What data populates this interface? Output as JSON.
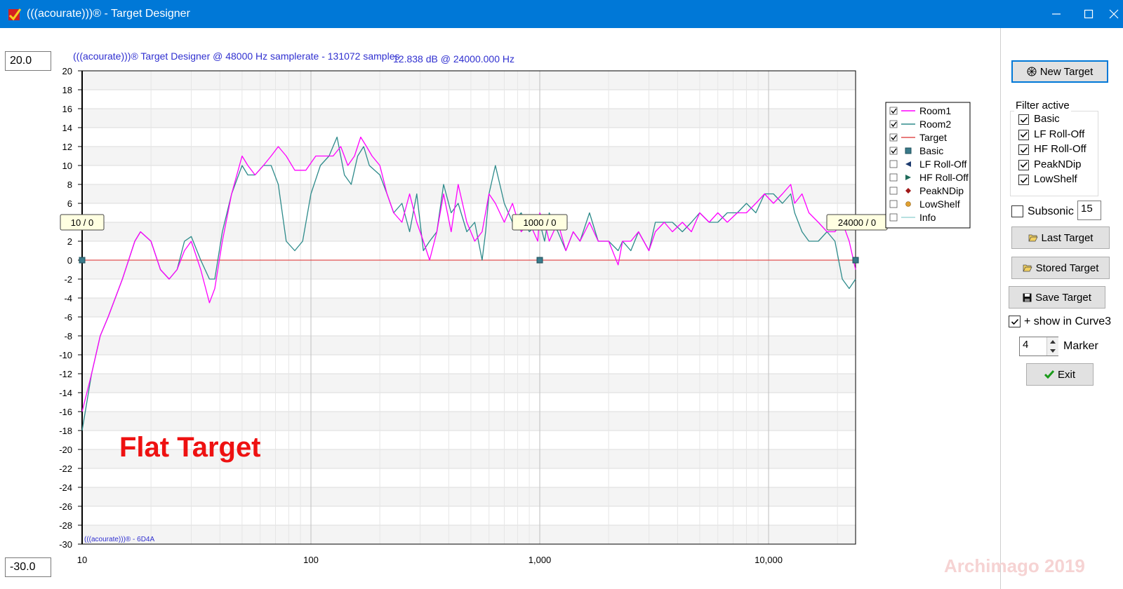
{
  "window": {
    "title": "(((acourate)))® - Target Designer",
    "titlebar_color": "#0078d7"
  },
  "scale": {
    "max": "20.0",
    "min": "-30.0"
  },
  "chart_data": {
    "type": "line",
    "title": "(((acourate)))® Target Designer @ 48000 Hz samplerate - 131072 samples",
    "readout": "12.838 dB @ 24000.000 Hz",
    "footer": "(((acourate)))® - 6D4A",
    "overlay_text": "Flat Target",
    "x_scale": "log",
    "xlim": [
      10,
      24000
    ],
    "ylim": [
      -30,
      20
    ],
    "x_ticks": [
      10,
      100,
      1000,
      10000
    ],
    "x_tick_labels": [
      "10",
      "100",
      "1,000",
      "10,000"
    ],
    "y_ticks": [
      20,
      18,
      16,
      14,
      12,
      10,
      8,
      6,
      4,
      2,
      0,
      -2,
      -4,
      -6,
      -8,
      -10,
      -12,
      -14,
      -16,
      -18,
      -20,
      -22,
      -24,
      -26,
      -28,
      -30
    ],
    "grid": true,
    "legend_position": "right",
    "legend": [
      {
        "name": "Room1",
        "checked": true,
        "color": "#ff00ff",
        "marker": "line"
      },
      {
        "name": "Room2",
        "checked": true,
        "color": "#2e8b8b",
        "marker": "line"
      },
      {
        "name": "Target",
        "checked": true,
        "color": "#e05050",
        "marker": "line"
      },
      {
        "name": "Basic",
        "checked": true,
        "color": "#3a7a8a",
        "marker": "square"
      },
      {
        "name": "LF Roll-Off",
        "checked": false,
        "color": "#1c3a6e",
        "marker": "tri-left"
      },
      {
        "name": "HF Roll-Off",
        "checked": false,
        "color": "#1e6b5a",
        "marker": "tri-right"
      },
      {
        "name": "PeakNDip",
        "checked": false,
        "color": "#a01818",
        "marker": "diamond"
      },
      {
        "name": "LowShelf",
        "checked": false,
        "color": "#e0a030",
        "marker": "circle"
      },
      {
        "name": "Info",
        "checked": false,
        "color": "#9fd6d6",
        "marker": "line"
      }
    ],
    "markers": [
      {
        "label": "10 / 0",
        "x": 10,
        "y": 0
      },
      {
        "label": "1000 / 0",
        "x": 1000,
        "y": 0
      },
      {
        "label": "24000 / 0",
        "x": 24000,
        "y": 0
      }
    ],
    "series": [
      {
        "name": "Room1",
        "color": "#ff00ff",
        "x": [
          10,
          11,
          12,
          13,
          15,
          17,
          18,
          20,
          22,
          24,
          26,
          28,
          30,
          33,
          36,
          38,
          41,
          45,
          50,
          53,
          57,
          62,
          67,
          72,
          78,
          85,
          95,
          105,
          115,
          125,
          135,
          145,
          155,
          165,
          175,
          185,
          200,
          215,
          230,
          250,
          270,
          290,
          310,
          330,
          355,
          380,
          410,
          440,
          480,
          520,
          560,
          600,
          640,
          700,
          760,
          830,
          900,
          980,
          1000,
          1050,
          1100,
          1200,
          1300,
          1400,
          1500,
          1650,
          1800,
          2000,
          2200,
          2300,
          2500,
          2700,
          3000,
          3200,
          3500,
          3800,
          4200,
          4600,
          5000,
          5500,
          6000,
          6600,
          7300,
          8000,
          8800,
          9600,
          10500,
          11500,
          12500,
          13000,
          14000,
          15000,
          16500,
          18000,
          19500,
          21000,
          22500,
          24000
        ],
        "y": [
          -16,
          -12,
          -8,
          -6,
          -2,
          2,
          3,
          2,
          -1,
          -2,
          -1,
          1,
          2,
          -1,
          -4.5,
          -3,
          2,
          7,
          11,
          10,
          9,
          10,
          11,
          12,
          11,
          9.5,
          9.5,
          11,
          11,
          11,
          12,
          10,
          11,
          13,
          12,
          11,
          10,
          7,
          5,
          4,
          7,
          4,
          2,
          0,
          3,
          7,
          3,
          8,
          4,
          2,
          3,
          7,
          6,
          4,
          6,
          3,
          4,
          2,
          5,
          4,
          2,
          4,
          1,
          3,
          2,
          4,
          2,
          2,
          -0.5,
          2,
          2,
          3,
          1,
          3,
          4,
          3,
          4,
          3,
          5,
          4,
          5,
          4,
          5,
          5,
          6,
          7,
          6,
          7,
          8,
          6,
          7,
          5,
          4,
          3,
          3,
          4,
          2,
          -1
        ]
      },
      {
        "name": "Room2",
        "color": "#2e8b8b",
        "x": [
          10,
          11,
          12,
          13,
          15,
          17,
          18,
          20,
          22,
          24,
          26,
          28,
          30,
          33,
          36,
          38,
          41,
          45,
          50,
          53,
          57,
          62,
          67,
          72,
          78,
          85,
          92,
          100,
          110,
          120,
          130,
          140,
          150,
          160,
          170,
          180,
          200,
          215,
          230,
          250,
          270,
          290,
          310,
          330,
          355,
          380,
          410,
          440,
          480,
          520,
          560,
          580,
          600,
          640,
          700,
          760,
          830,
          900,
          1000,
          1050,
          1100,
          1200,
          1300,
          1400,
          1500,
          1650,
          1800,
          2000,
          2200,
          2300,
          2500,
          2700,
          3000,
          3200,
          3500,
          3800,
          4200,
          4600,
          5000,
          5500,
          6000,
          6600,
          7300,
          8000,
          8800,
          9600,
          10500,
          11500,
          12500,
          13000,
          14000,
          15000,
          16500,
          18000,
          19500,
          21000,
          22500,
          24000
        ],
        "y": [
          -18,
          -12,
          -8,
          -6,
          -2,
          2,
          3,
          2,
          -1,
          -2,
          -1,
          2,
          2.5,
          0,
          -2,
          -2,
          3,
          7,
          10,
          9,
          9,
          10,
          10,
          8,
          2,
          1,
          2,
          7,
          10,
          11,
          13,
          9,
          8,
          11,
          12,
          10,
          9,
          7,
          5,
          6,
          3,
          7,
          1,
          2,
          3,
          8,
          5,
          6,
          3,
          4,
          0,
          3,
          7,
          10,
          6,
          4,
          5,
          3,
          4,
          2,
          5,
          3,
          1,
          3,
          2,
          5,
          2,
          2,
          1,
          2,
          1,
          3,
          1,
          4,
          4,
          4,
          3,
          4,
          5,
          4,
          4,
          5,
          5,
          6,
          5,
          7,
          7,
          6,
          7,
          5,
          3,
          2,
          2,
          3,
          2,
          -2,
          -3,
          -2
        ]
      }
    ]
  },
  "panel": {
    "new_target": "New Target",
    "filter_title": "Filter active",
    "filters": [
      {
        "label": "Basic",
        "checked": true
      },
      {
        "label": "LF Roll-Off",
        "checked": true
      },
      {
        "label": "HF Roll-Off",
        "checked": true
      },
      {
        "label": "PeakNDip",
        "checked": true
      },
      {
        "label": "LowShelf",
        "checked": true
      }
    ],
    "subsonic_label": "Subsonic",
    "subsonic_checked": false,
    "subsonic_value": "15",
    "last_target": "Last Target",
    "stored_target": "Stored Target",
    "save_target": "Save Target",
    "show_curve3": "+ show in Curve3",
    "show_curve3_checked": true,
    "marker_value": "4",
    "marker_label": "Marker",
    "exit": "Exit"
  },
  "watermark": "Archimago 2019"
}
